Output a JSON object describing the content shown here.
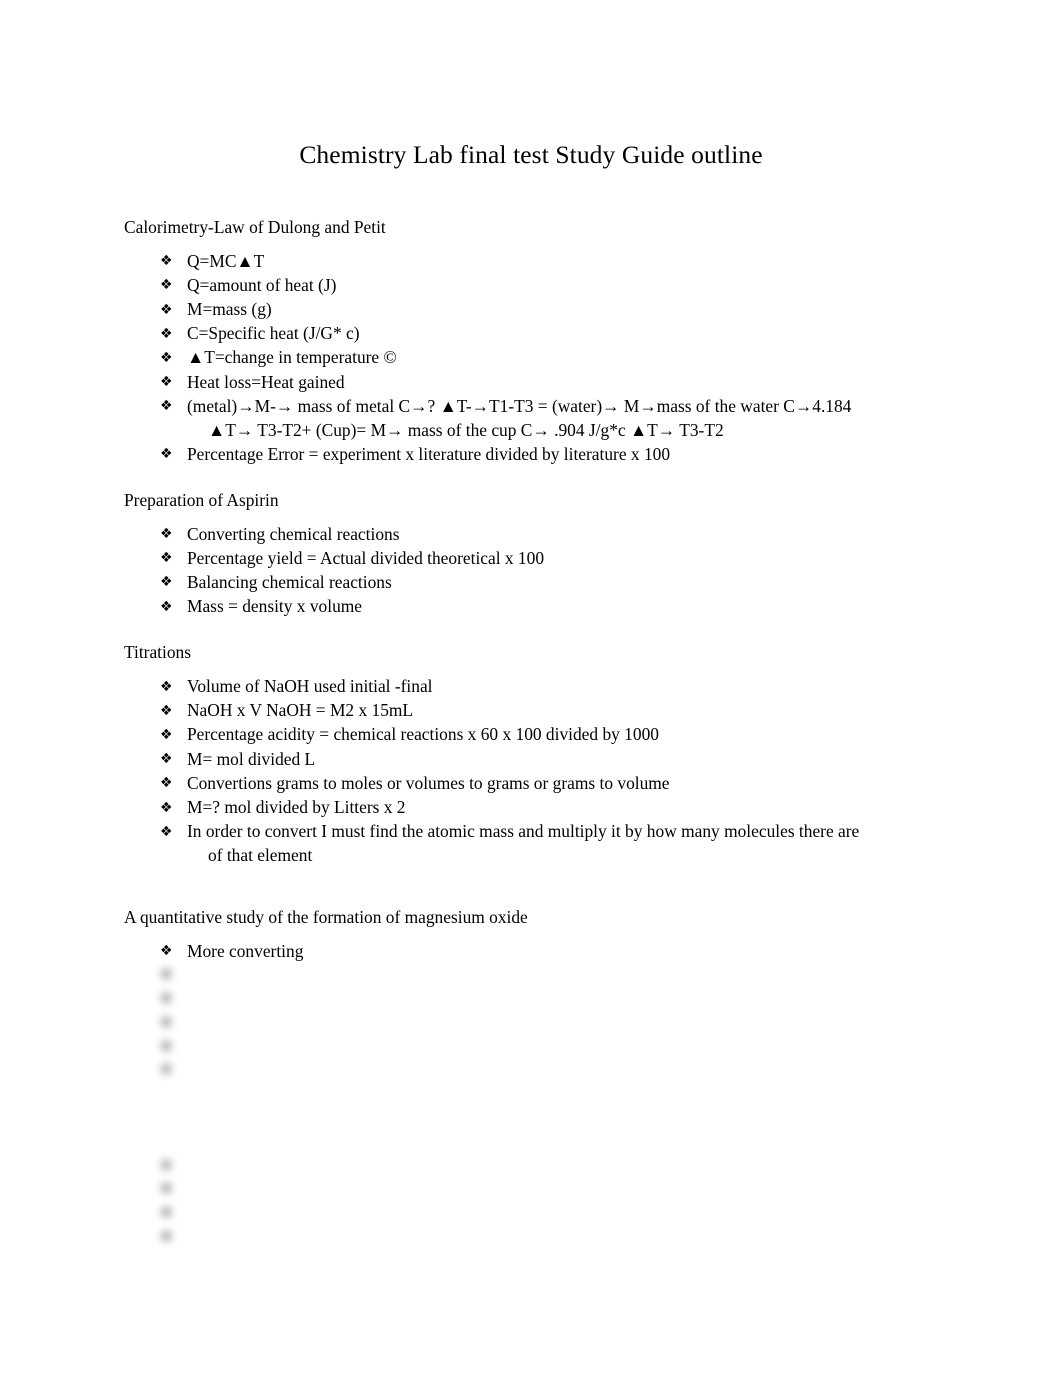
{
  "document": {
    "title": "Chemistry Lab final test Study Guide outline",
    "bullet_glyph": "❖",
    "arrow_glyph": "→",
    "triangle_glyph": "▲"
  },
  "sections": [
    {
      "heading": "Calorimetry-Law of Dulong and Petit",
      "items": [
        {
          "text": "Q=MC▲T"
        },
        {
          "text": "Q=amount of heat (J)"
        },
        {
          "text": "M=mass (g)"
        },
        {
          "text": "C=Specific heat (J/G* c)"
        },
        {
          "text": "▲T=change in temperature ©"
        },
        {
          "text": "Heat loss=Heat gained"
        },
        {
          "text": "(metal)→M-→ mass of metal C→? ▲T-→T1-T3 = (water)→ M→mass of the water C→4.184",
          "continuation": "▲T→ T3-T2+ (Cup)= M→ mass of the cup C→ .904 J/g*c ▲T→ T3-T2"
        },
        {
          "text": "Percentage Error = experiment x literature divided by literature x 100"
        }
      ]
    },
    {
      "heading": "Preparation of Aspirin",
      "items": [
        {
          "text": "Converting chemical reactions"
        },
        {
          "text": "Percentage yield = Actual divided theoretical x 100"
        },
        {
          "text": "Balancing chemical reactions"
        },
        {
          "text": "Mass = density x volume"
        }
      ]
    },
    {
      "heading": "Titrations",
      "items": [
        {
          "text": "Volume of NaOH used initial -final"
        },
        {
          "text": "NaOH x V NaOH = M2 x 15mL"
        },
        {
          "text": "Percentage acidity = chemical reactions x 60 x 100 divided by 1000"
        },
        {
          "text": "M= mol divided L"
        },
        {
          "text": "Convertions grams to moles or volumes to grams or grams to volume"
        },
        {
          "text": "M=? mol divided by Litters x 2"
        },
        {
          "text": "In order to convert I must find the atomic mass and multiply it by how many molecules there are",
          "continuation": "of that element"
        }
      ]
    },
    {
      "heading": "A quantitative study of the formation of magnesium oxide",
      "items": [
        {
          "text": "More converting"
        }
      ]
    }
  ],
  "obscured": {
    "note": "trailing content is blurred and unreadable in the screenshot",
    "block_one": [
      "        ",
      "          ",
      "                      ",
      "                    ",
      "                             "
    ],
    "block_two_heading": "          ",
    "block_two": [
      "           ",
      "            ",
      "       ",
      "     "
    ]
  }
}
